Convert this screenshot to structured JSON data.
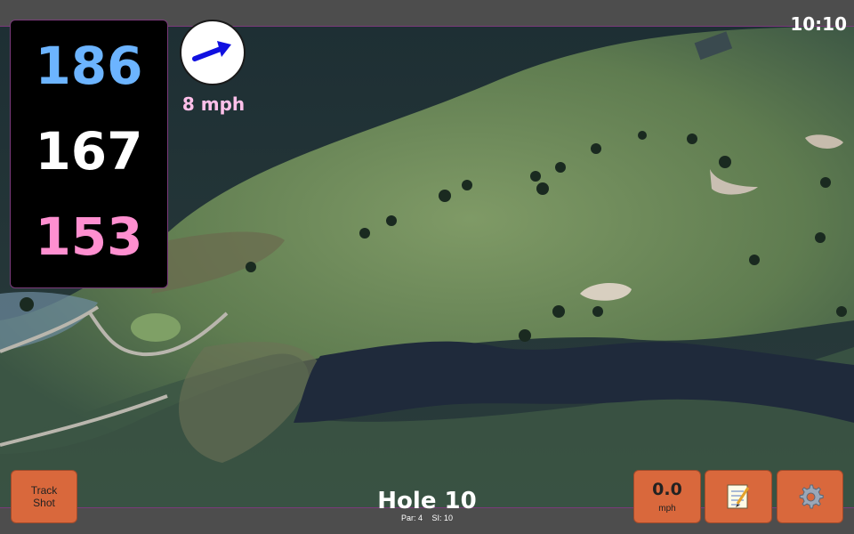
{
  "status": {
    "time": "10:10"
  },
  "distances": {
    "back": "186",
    "center": "167",
    "front": "153"
  },
  "wind": {
    "speed_label": "8 mph",
    "arrow_color": "#1010e0",
    "icon": "wind-arrow-icon"
  },
  "hole": {
    "title": "Hole 10",
    "par_label": "Par: 4",
    "si_label": "SI: 10"
  },
  "buttons": {
    "track_shot_line1": "Track",
    "track_shot_line2": "Shot",
    "speed_value": "0.0",
    "speed_unit": "mph",
    "notes_icon": "notepad-icon",
    "settings_icon": "gear-icon"
  },
  "colors": {
    "back_distance": "#6cb4ff",
    "center_distance": "#ffffff",
    "front_distance": "#ff8fd0",
    "button_bg": "#d9683c",
    "accent_border": "#7a3a7a"
  }
}
